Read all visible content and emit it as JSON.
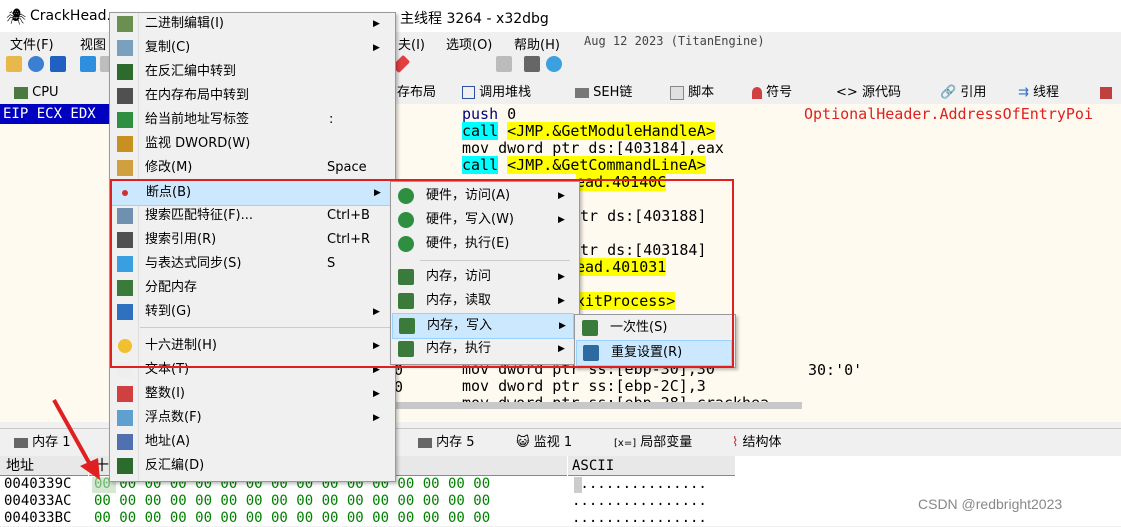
{
  "window": {
    "title_left": "CrackHead.e",
    "title_right": "主线程 3264 - x32dbg"
  },
  "menubar": {
    "items": [
      "文件(F)",
      "视图",
      "夫(I)",
      "选项(O)",
      "帮助(H)",
      "Aug 12 2023  (TitanEngine)"
    ]
  },
  "tabs": [
    "CPU",
    "存布局",
    "调用堆栈",
    "SEH链",
    "脚本",
    "符号",
    "源代码",
    "引用",
    "线程"
  ],
  "registers": {
    "label": "EIP ECX EDX"
  },
  "disasm": {
    "lines": [
      {
        "op": "push ",
        "rest": "0"
      },
      {
        "op": "call",
        "target": "<JMP.&GetModuleHandleA>"
      },
      {
        "op": "mov ",
        "rest": "dword ptr ds:[403184],eax"
      },
      {
        "op": "call",
        "target": "<JMP.&GetCommandLineA>"
      },
      {
        "frag": "ead.40140C"
      },
      {
        "frag": "tr ds:[403188]"
      },
      {
        "frag": "tr ds:[403184]"
      },
      {
        "frag": "ead.401031"
      },
      {
        "frag": "xitProcess>"
      },
      {
        "op": "mov ",
        "rest": "dword ptr ss:[ebp-30],30"
      },
      {
        "op": "mov ",
        "rest": "dword ptr ss:[ebp-2C],3"
      },
      {
        "op": "mov ",
        "rest": "dword ptr ss:[ebp-28],crackhea"
      }
    ],
    "comment_top": "OptionalHeader.AddressOfEntryPoi",
    "comment_mid": "30:'0'",
    "col_left": "0"
  },
  "bottom_tabs": [
    "内存 1",
    "内存 5",
    "监视 1",
    "局部变量",
    "结构体"
  ],
  "dump": {
    "header_addr": "地址",
    "header_hex": "十",
    "header_ascii": "ASCII",
    "rows": [
      {
        "addr": "0040339C",
        "hex": "00 00 00 00 00 00 00 00 00 00 00 00 00 00 00 00",
        "ascii": "................"
      },
      {
        "addr": "004033AC",
        "hex": "00 00 00 00 00 00 00 00 00 00 00 00 00 00 00 00",
        "ascii": "................"
      },
      {
        "addr": "004033BC",
        "hex": "00 00 00 00 00 00 00 00 00 00 00 00 00 00 00 00",
        "ascii": "................"
      }
    ]
  },
  "menu_main": [
    {
      "label": "二进制编辑(I)",
      "icon": "binary-edit-icon",
      "arrow": true
    },
    {
      "label": "复制(C)",
      "icon": "copy-icon",
      "arrow": true
    },
    {
      "label": "在反汇编中转到",
      "icon": "disasm-goto-icon"
    },
    {
      "label": "在内存布局中转到",
      "icon": "memmap-goto-icon"
    },
    {
      "label": "给当前地址写标签",
      "shortcut": ":",
      "icon": "label-icon"
    },
    {
      "label": "监视 DWORD(W)",
      "icon": "watch-icon"
    },
    {
      "label": "修改(M)",
      "shortcut": "Space",
      "icon": "pencil-icon"
    },
    {
      "label": "断点(B)",
      "icon": "breakpoint-icon",
      "arrow": true
    },
    {
      "label": "搜索匹配特征(F)...",
      "shortcut": "Ctrl+B",
      "icon": "search-pattern-icon"
    },
    {
      "label": "搜索引用(R)",
      "shortcut": "Ctrl+R",
      "icon": "binoculars-icon"
    },
    {
      "label": "与表达式同步(S)",
      "shortcut": "S",
      "icon": "sync-icon"
    },
    {
      "label": "分配内存",
      "icon": "alloc-memory-icon"
    },
    {
      "label": "转到(G)",
      "icon": "goto-icon",
      "arrow": true
    },
    {
      "label": "十六进制(H)",
      "icon": "smiley-icon",
      "arrow": true
    },
    {
      "label": "文本(T)",
      "icon": "text-icon",
      "arrow": true
    },
    {
      "label": "整数(I)",
      "icon": "integer-icon",
      "arrow": true
    },
    {
      "label": "浮点数(F)",
      "icon": "float-icon",
      "arrow": true
    },
    {
      "label": "地址(A)",
      "icon": "address-icon"
    },
    {
      "label": "反汇编(D)",
      "icon": "disasm-icon"
    }
  ],
  "menu_bp": [
    {
      "label": "硬件，访问(A)",
      "arrow": true
    },
    {
      "label": "硬件，写入(W)",
      "arrow": true
    },
    {
      "label": "硬件，执行(E)"
    },
    {
      "label": "内存，访问",
      "arrow": true
    },
    {
      "label": "内存，读取",
      "arrow": true
    },
    {
      "label": "内存，写入",
      "arrow": true
    },
    {
      "label": "内存，执行",
      "arrow": true
    }
  ],
  "menu_write": [
    {
      "label": "一次性(S)"
    },
    {
      "label": "重复设置(R)"
    }
  ],
  "watermark": "CSDN @redbright2023",
  "colors": {
    "accent_highlight": "#cce8ff",
    "annotation_red": "#e02020",
    "label_yellow": "#ffff00",
    "call_cyan": "#00ffff"
  }
}
